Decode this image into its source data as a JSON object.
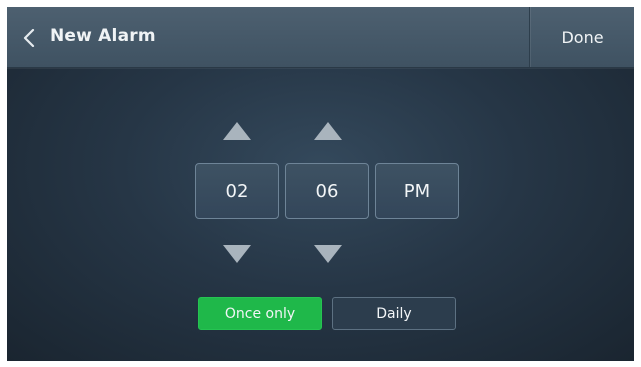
{
  "header": {
    "title": "New Alarm",
    "done_label": "Done",
    "back_icon": "chevron-left-icon"
  },
  "time": {
    "hour": "02",
    "minute": "06",
    "period": "PM"
  },
  "repeat": {
    "options": [
      "Once only",
      "Daily"
    ],
    "selected": "Once only"
  },
  "colors": {
    "accent_selected": "#1fb84a",
    "arrow": "#a9b4bd"
  }
}
